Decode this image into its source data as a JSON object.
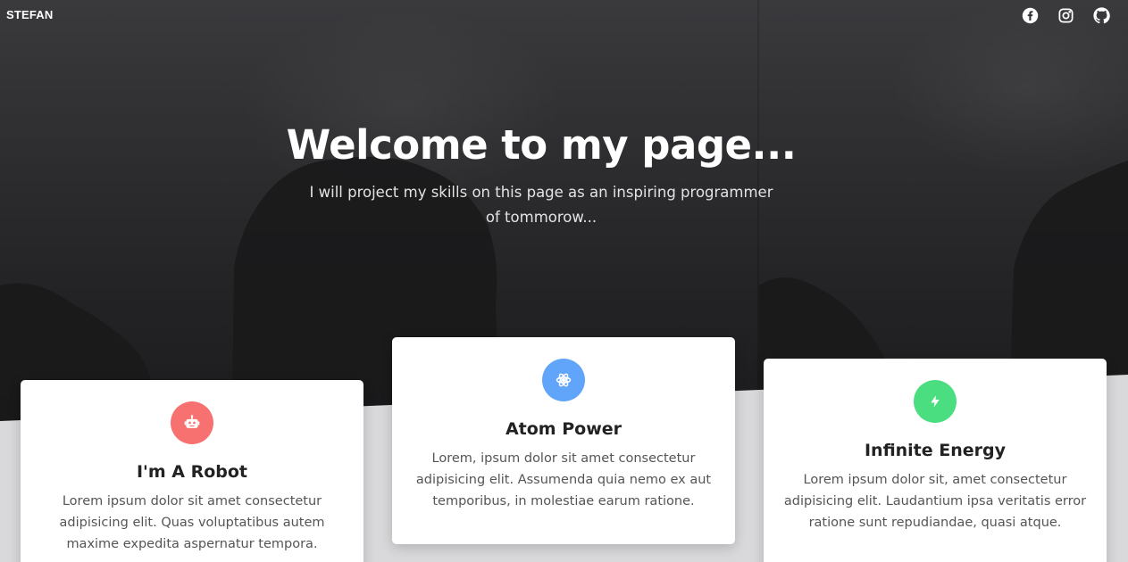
{
  "nav": {
    "brand": "STEFAN",
    "social": [
      {
        "icon": "facebook-icon"
      },
      {
        "icon": "instagram-icon"
      },
      {
        "icon": "github-icon"
      }
    ]
  },
  "hero": {
    "title": "Welcome to my page...",
    "subtitle": "I will project my skills on this page as an inspiring programmer of tommorow..."
  },
  "cards": [
    {
      "icon": "robot-icon",
      "icon_color": "#f87171",
      "title": "I'm A Robot",
      "text": "Lorem ipsum dolor sit amet consectetur adipisicing elit. Quas voluptatibus autem maxime expedita aspernatur tempora."
    },
    {
      "icon": "atom-icon",
      "icon_color": "#60a5fa",
      "title": "Atom Power",
      "text": "Lorem, ipsum dolor sit amet consectetur adipisicing elit. Assumenda quia nemo ex aut temporibus, in molestiae earum ratione."
    },
    {
      "icon": "bolt-icon",
      "icon_color": "#4ade80",
      "title": "Infinite Energy",
      "text": "Lorem ipsum dolor sit, amet consectetur adipisicing elit. Laudantium ipsa veritatis error ratione sunt repudiandae, quasi atque."
    }
  ],
  "colors": {
    "hero_bg": "#2e2e31",
    "page_bg": "#d9d9db",
    "card_bg": "#ffffff"
  }
}
